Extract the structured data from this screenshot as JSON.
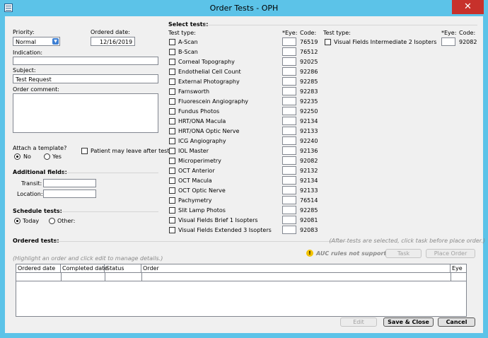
{
  "window": {
    "title": "Order Tests - OPH",
    "close_glyph": "✕"
  },
  "priority": {
    "label": "Priority:",
    "value": "Normal"
  },
  "ordered_date": {
    "label": "Ordered date:",
    "value": "12/16/2019"
  },
  "indication": {
    "label": "Indication:",
    "value": ""
  },
  "subject": {
    "label": "Subject:",
    "value": "Test Request"
  },
  "order_comment": {
    "label": "Order comment:",
    "value": ""
  },
  "attach_template": {
    "label": "Attach a template?",
    "no_label": "No",
    "yes_label": "Yes",
    "selected": "No"
  },
  "patient_may_leave": {
    "label": "Patient may leave after test",
    "checked": false
  },
  "additional_fields": {
    "title": "Additional fields:",
    "transit_label": "Transit:",
    "location_label": "Location:",
    "transit_value": "",
    "location_value": ""
  },
  "schedule_tests": {
    "title": "Schedule tests:",
    "today_label": "Today",
    "other_label": "Other:",
    "selected": "Today"
  },
  "select_tests": {
    "title": "Select tests:",
    "headers": {
      "test_type": "Test type:",
      "eye": "*Eye:",
      "code": "Code:"
    },
    "left": [
      {
        "name": "A-Scan",
        "code": "76519"
      },
      {
        "name": "B-Scan",
        "code": "76512"
      },
      {
        "name": "Corneal Topography",
        "code": "92025"
      },
      {
        "name": "Endothelial Cell Count",
        "code": "92286"
      },
      {
        "name": "External Photography",
        "code": "92285"
      },
      {
        "name": "Farnsworth",
        "code": "92283"
      },
      {
        "name": "Fluorescein Angiography",
        "code": "92235"
      },
      {
        "name": "Fundus Photos",
        "code": "92250"
      },
      {
        "name": "HRT/ONA Macula",
        "code": "92134"
      },
      {
        "name": "HRT/ONA Optic Nerve",
        "code": "92133"
      },
      {
        "name": "ICG Angiography",
        "code": "92240"
      },
      {
        "name": "IOL Master",
        "code": "92136"
      },
      {
        "name": "Microperimetry",
        "code": "92082"
      },
      {
        "name": "OCT Anterior",
        "code": "92132"
      },
      {
        "name": "OCT Macula",
        "code": "92134"
      },
      {
        "name": "OCT Optic Nerve",
        "code": "92133"
      },
      {
        "name": "Pachymetry",
        "code": "76514"
      },
      {
        "name": "Slit Lamp Photos",
        "code": "92285"
      },
      {
        "name": "Visual Fields Brief 1 Isopters",
        "code": "92081"
      },
      {
        "name": "Visual Fields Extended 3 Isopters",
        "code": "92083"
      }
    ],
    "right": [
      {
        "name": "Visual Fields Intermediate 2 Isopters",
        "code": "92082"
      }
    ]
  },
  "ordered_tests": {
    "title": "Ordered tests:",
    "hint": "(After tests are selected, click task before place order.)",
    "manage_hint": "(Highlight an order and click edit to manage details.)",
    "auc_message": "AUC rules not supported.",
    "warn_glyph": "!",
    "task_label": "Task",
    "place_order_label": "Place Order",
    "columns": [
      "Ordered date",
      "Completed date",
      "Status",
      "Order",
      "Eye"
    ]
  },
  "footer": {
    "edit_label": "Edit",
    "save_close_label": "Save & Close",
    "cancel_label": "Cancel"
  }
}
